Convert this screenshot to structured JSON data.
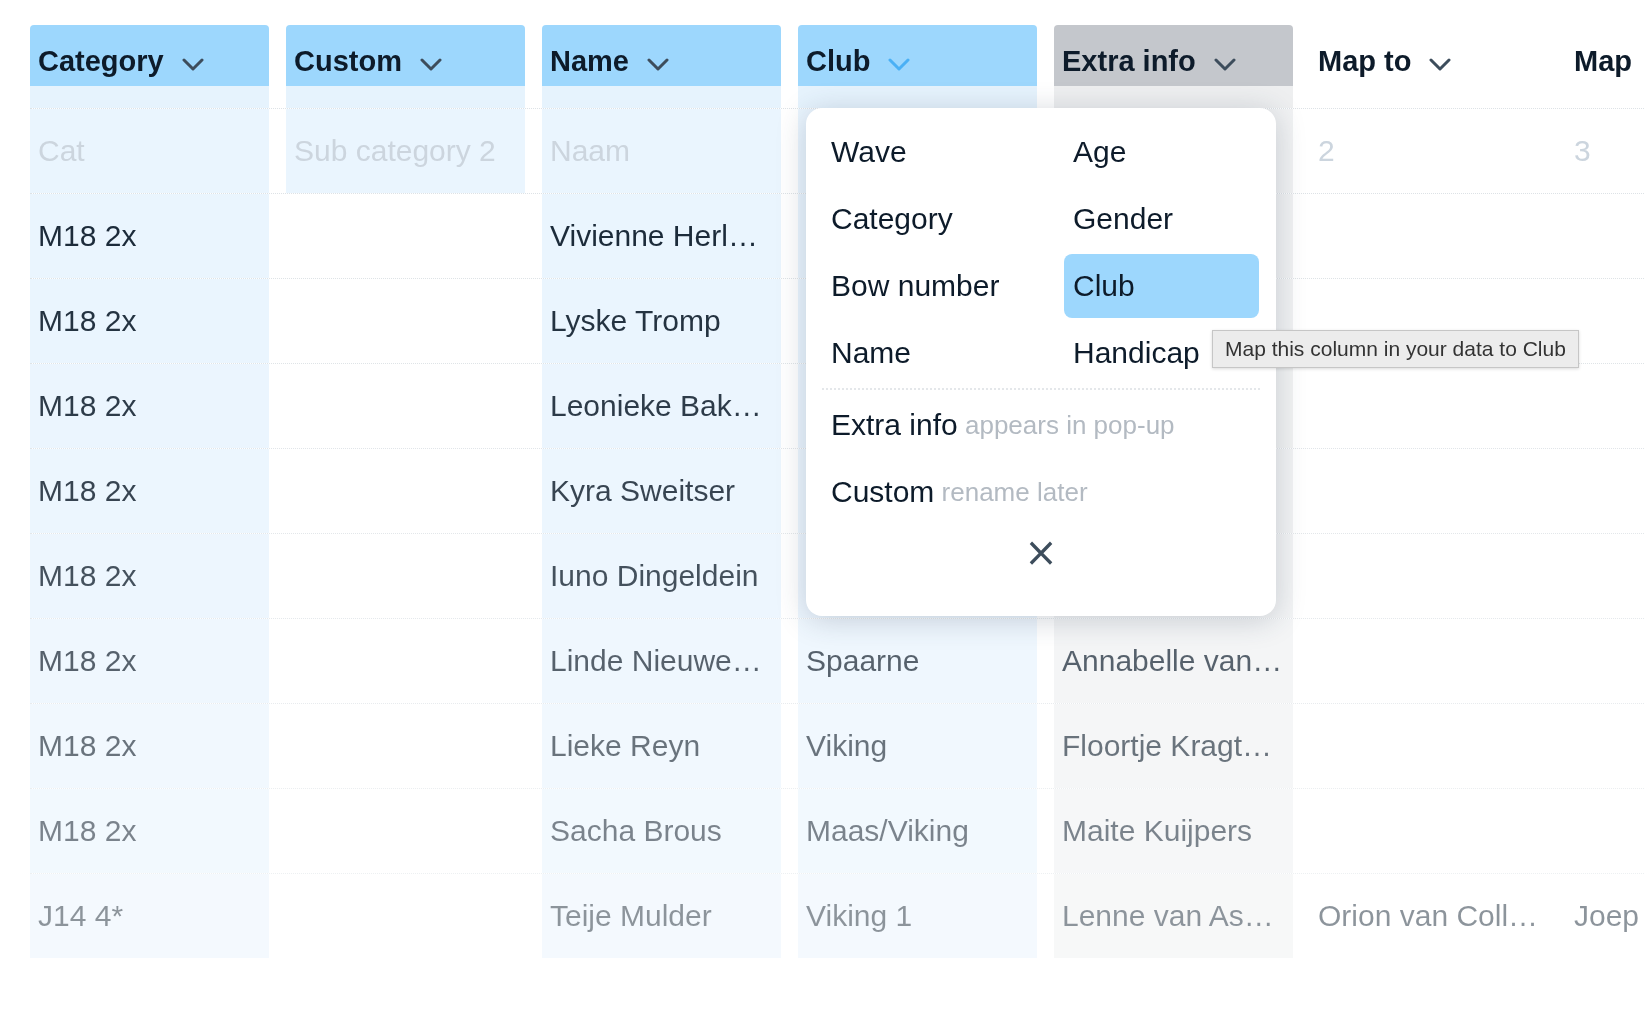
{
  "columns": [
    {
      "label": "Category",
      "kind": "mapped",
      "open": false
    },
    {
      "label": "Custom",
      "kind": "custom",
      "open": false
    },
    {
      "label": "Name",
      "kind": "mapped",
      "open": false
    },
    {
      "label": "Club",
      "kind": "mapped",
      "open": true
    },
    {
      "label": "Extra info",
      "kind": "extra",
      "open": false
    },
    {
      "label": "Map to",
      "kind": "unmapped",
      "open": false
    },
    {
      "label": "Map",
      "kind": "unmapped"
    }
  ],
  "rows": [
    {
      "kind": "placeholder",
      "cells": [
        "Cat",
        "Sub category 2",
        "Naam",
        null,
        null,
        "2",
        "3"
      ]
    },
    {
      "kind": "data",
      "cells": [
        "M18 2x",
        null,
        "Vivienne Herl…",
        null,
        null,
        null,
        null
      ]
    },
    {
      "kind": "data",
      "cells": [
        "M18 2x",
        null,
        "Lyske Tromp",
        null,
        null,
        null,
        null
      ]
    },
    {
      "kind": "data",
      "cells": [
        "M18 2x",
        null,
        "Leonieke Bak…",
        null,
        null,
        null,
        null
      ]
    },
    {
      "kind": "data",
      "cells": [
        "M18 2x",
        null,
        "Kyra Sweitser",
        null,
        null,
        null,
        null
      ]
    },
    {
      "kind": "data",
      "cells": [
        "M18 2x",
        null,
        "Iuno Dingeldein",
        null,
        null,
        null,
        null
      ]
    },
    {
      "kind": "data",
      "cells": [
        "M18 2x",
        null,
        "Linde Nieuwe…",
        "Spaarne",
        "Annabelle van…",
        null,
        null
      ]
    },
    {
      "kind": "data",
      "cells": [
        "M18 2x",
        null,
        "Lieke Reyn",
        "Viking",
        "Floortje Kragt…",
        null,
        null
      ]
    },
    {
      "kind": "data",
      "cells": [
        "M18 2x",
        null,
        "Sacha Brous",
        "Maas/Viking",
        "Maite Kuijpers",
        null,
        null
      ]
    },
    {
      "kind": "data",
      "cells": [
        "J14 4*",
        null,
        "Teije Mulder",
        "Viking 1",
        "Lenne van As…",
        "Orion van Coll…",
        "Joep"
      ]
    }
  ],
  "mapping_menu": {
    "options": [
      {
        "label": "Wave",
        "selected": false
      },
      {
        "label": "Age",
        "selected": false
      },
      {
        "label": "Category",
        "selected": false
      },
      {
        "label": "Gender",
        "selected": false
      },
      {
        "label": "Bow number",
        "selected": false
      },
      {
        "label": "Club",
        "selected": true
      },
      {
        "label": "Name",
        "selected": false
      },
      {
        "label": "Handicap",
        "selected": false
      }
    ],
    "extra_options": [
      {
        "label": "Extra info",
        "hint": "appears in pop-up",
        "selected": false
      },
      {
        "label": "Custom",
        "hint": "rename later",
        "selected": false
      }
    ],
    "close": "×"
  },
  "tooltip": "Map this column in your data to Club"
}
